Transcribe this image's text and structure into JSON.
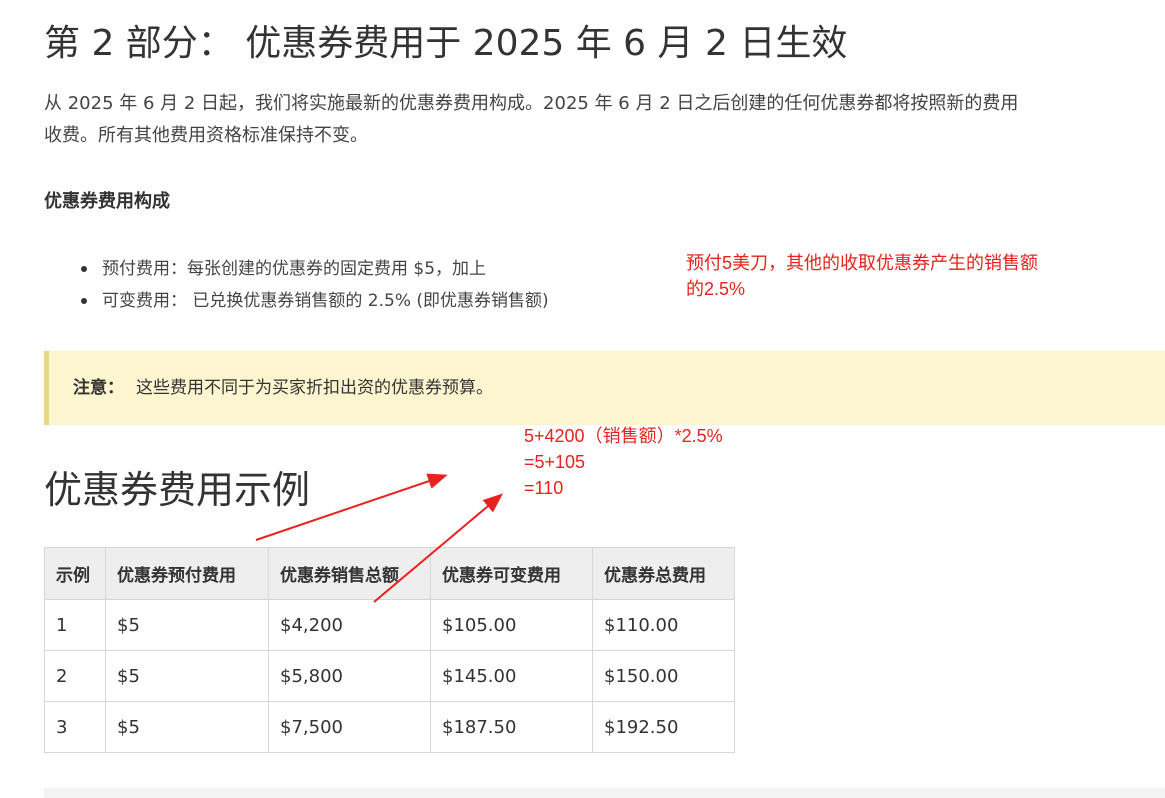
{
  "section_title": "第 2 部分： 优惠券费用于 2025 年 6 月 2 日生效",
  "intro": {
    "line1": "从 2025 年 6 月 2 日起，我们将实施最新的优惠券费用构成。2025 年 6 月 2 日之后创建的任何优惠券都将按照新的费用",
    "line2": "收费。所有其他费用资格标准保持不变。"
  },
  "structure_heading": "优惠券费用构成",
  "fee_items": [
    "预付费用：每张创建的优惠券的固定费用 $5，加上",
    "可变费用： 已兑换优惠券销售额的 2.5% (即优惠券销售额)"
  ],
  "note": {
    "label": "注意：",
    "text": "这些费用不同于为买家折扣出资的优惠券预算。"
  },
  "example_title": "优惠券费用示例",
  "table": {
    "headers": [
      "示例",
      "优惠券预付费用",
      "优惠券销售总额",
      "优惠券可变费用",
      "优惠券总费用"
    ],
    "rows": [
      [
        "1",
        "$5",
        "$4,200",
        "$105.00",
        "$110.00"
      ],
      [
        "2",
        "$5",
        "$5,800",
        "$145.00",
        "$150.00"
      ],
      [
        "3",
        "$5",
        "$7,500",
        "$187.50",
        "$192.50"
      ]
    ]
  },
  "annotations": {
    "fee_note": {
      "line1": "预付5美刀，其他的收取优惠券产生的销售额",
      "line2": "的2.5%"
    },
    "calc": {
      "line1": "5+4200（销售额）*2.5%",
      "line2": "=5+105",
      "line3": "=110"
    },
    "color": "#e8231f"
  },
  "colors": {
    "note_background": "#fcf5cf",
    "note_border": "#e8d78a",
    "table_header_background": "#eeeeee"
  }
}
